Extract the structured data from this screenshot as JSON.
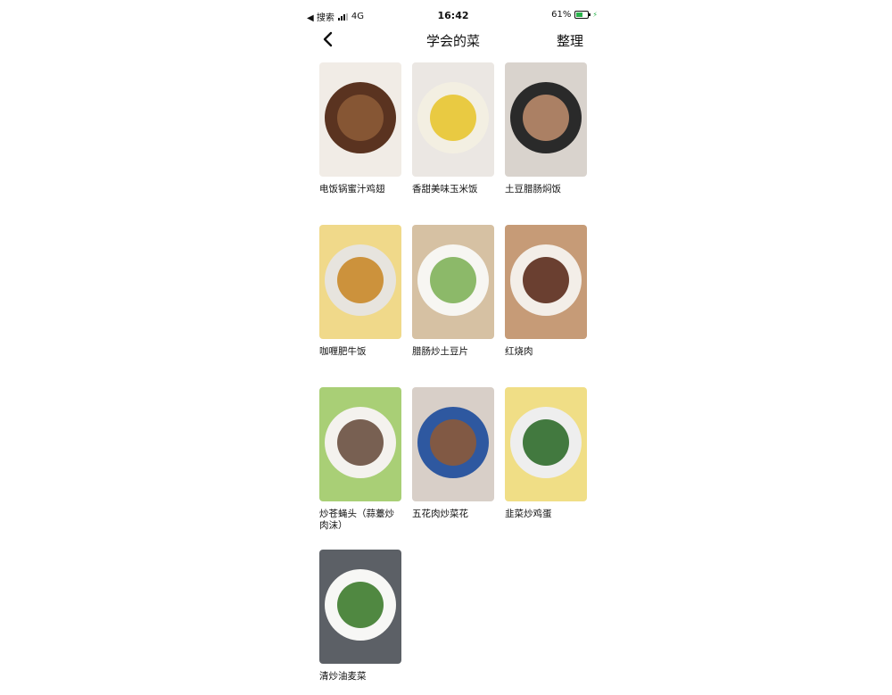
{
  "status_bar": {
    "back_app": "◀ 搜索",
    "network": "4G",
    "time": "16:42",
    "battery": "61%",
    "battery_level": 0.61
  },
  "nav": {
    "title": "学会的菜",
    "action": "整理",
    "back_icon": "chevron-left-icon"
  },
  "dishes": [
    {
      "name": "电饭锅蜜汁鸡翅",
      "colors": [
        "#f1ece6",
        "#5a3320",
        "#8b5a36"
      ]
    },
    {
      "name": "香甜美味玉米饭",
      "colors": [
        "#ebe7e3",
        "#f3efe2",
        "#e8c531"
      ]
    },
    {
      "name": "土豆腊肠焖饭",
      "colors": [
        "#d9d3cd",
        "#2a2a2a",
        "#b98a6a"
      ]
    },
    {
      "name": "咖喱肥牛饭",
      "colors": [
        "#f0d98a",
        "#e7e4de",
        "#c9882a"
      ]
    },
    {
      "name": "腊肠炒土豆片",
      "colors": [
        "#d6c1a3",
        "#f7f6f2",
        "#7fb25a"
      ]
    },
    {
      "name": "红烧肉",
      "colors": [
        "#c69b77",
        "#f3eee8",
        "#5b2b1c"
      ]
    },
    {
      "name": "炒苍蝇头（蒜薹炒肉沫）",
      "colors": [
        "#a9cf76",
        "#f4f2ee",
        "#6a5040"
      ]
    },
    {
      "name": "五花肉炒菜花",
      "colors": [
        "#d8cfc8",
        "#2e58a0",
        "#8b5a3a"
      ]
    },
    {
      "name": "韭菜炒鸡蛋",
      "colors": [
        "#f0de86",
        "#eeeeee",
        "#2f6b2b"
      ]
    },
    {
      "name": "清炒油麦菜",
      "colors": [
        "#5c6066",
        "#f7f7f5",
        "#3d7b2e"
      ]
    }
  ]
}
